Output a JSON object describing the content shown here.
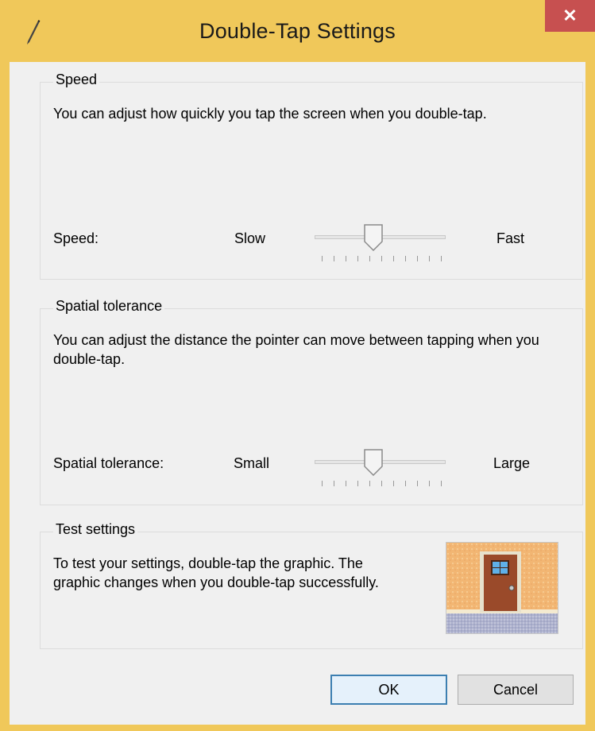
{
  "window": {
    "title": "Double-Tap Settings",
    "close_symbol": "✕",
    "app_icon": "pen-icon"
  },
  "speed_group": {
    "title": "Speed",
    "description": "You can adjust how quickly you tap the screen when you double-tap.",
    "label": "Speed:",
    "min_label": "Slow",
    "max_label": "Fast",
    "slider": {
      "position": 4,
      "max": 10
    }
  },
  "tolerance_group": {
    "title": "Spatial tolerance",
    "description": "You can adjust the distance the pointer can move between tapping when you double-tap.",
    "label": "Spatial tolerance:",
    "min_label": "Small",
    "max_label": "Large",
    "slider": {
      "position": 4,
      "max": 10
    }
  },
  "test_group": {
    "title": "Test settings",
    "description": "To test your settings, double-tap the graphic. The graphic changes when you double-tap successfully.",
    "image": "door-icon"
  },
  "buttons": {
    "ok": "OK",
    "cancel": "Cancel"
  },
  "colors": {
    "titlebar": "#f0c85a",
    "close_button": "#c75050",
    "client": "#f0f0f0",
    "ok_border": "#3c7fb1"
  }
}
